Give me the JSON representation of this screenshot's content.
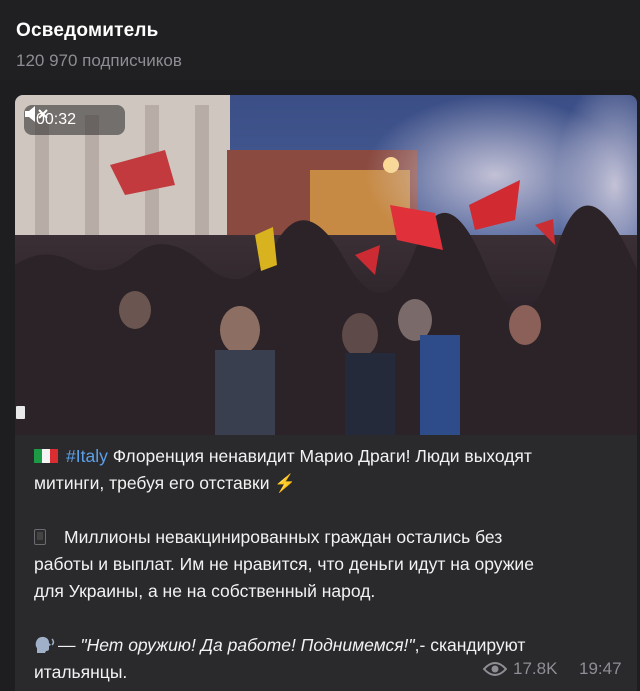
{
  "header": {
    "channel_name": "Осведомитель",
    "subscribers": "120 970 подписчиков",
    "dots": "…"
  },
  "post": {
    "video": {
      "duration": "00:32",
      "muted_icon": "speaker-muted-icon"
    },
    "text": {
      "flag_icon": "italy-flag-icon",
      "hashtag": "#Italy",
      "line1_rest": " Флоренция ненавидит Марио Драги! Люди выходят",
      "line2": "митинги, требуя его отставки",
      "bolt": "⚡",
      "phone_icon": "mobile-phone-icon",
      "para2_line1": "Миллионы невакцинированных граждан остались без",
      "para2_line2": "работы и выплат. Им не нравится, что деньги идут на оружие",
      "para2_line3": "для Украины, а не на собственный народ.",
      "speak_icon": "speaking-head-icon",
      "para3_dash": "— ",
      "para3_quote": "\"Нет оружию! Да работе! Поднимемся!\"",
      "para3_rest": ",- скандируют",
      "para3_line2": "итальянцы."
    },
    "meta": {
      "views": "17.8K",
      "time": "19:47"
    }
  },
  "colors": {
    "background": "#1e1e20",
    "bubble": "#2a2a2d",
    "link": "#5ba0e8",
    "muted_text": "#8e8e94"
  }
}
